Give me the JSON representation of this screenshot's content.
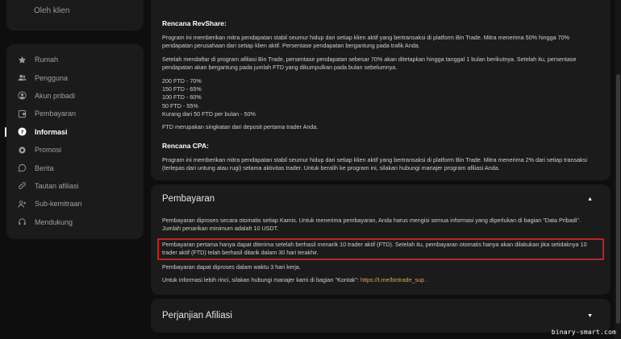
{
  "sidebar_top": {
    "label": "Oleh klien"
  },
  "sidebar": {
    "items": [
      {
        "label": "Rumah",
        "icon": "star-icon",
        "active": false
      },
      {
        "label": "Pengguna",
        "icon": "users-icon",
        "active": false
      },
      {
        "label": "Akun pribadi",
        "icon": "account-icon",
        "active": false
      },
      {
        "label": "Pembayaran",
        "icon": "wallet-icon",
        "active": false
      },
      {
        "label": "Informasi",
        "icon": "question-icon",
        "active": true
      },
      {
        "label": "Promosi",
        "icon": "gear-icon",
        "active": false
      },
      {
        "label": "Berita",
        "icon": "chat-icon",
        "active": false
      },
      {
        "label": "Tautan afiliasi",
        "icon": "link-icon",
        "active": false
      },
      {
        "label": "Sub-kemitraan",
        "icon": "add-user-icon",
        "active": false
      },
      {
        "label": "Mendukung",
        "icon": "headset-icon",
        "active": false
      }
    ]
  },
  "revshare": {
    "title": "Rencana RevShare:",
    "p1": "Program ini memberikan mitra pendapatan stabil seumur hidup dari setiap klien aktif yang bertransaksi di platform Bin Trade. Mitra menerima 50% hingga 70% pendapatan perusahaan dari setiap klien aktif. Persentase pendapatan bergantung pada trafik Anda.",
    "p2": "Setelah mendaftar di program afiliasi Bin Trade, persentase pendapatan sebesar 70% akan ditetapkan hingga tanggal 1 bulan berikutnya. Setelah itu, persentase pendapatan akan bergantung pada jumlah FTD yang dikumpulkan pada bulan sebelumnya.",
    "tiers": [
      "200 FTD - 70%",
      "150 FTD - 65%",
      "100 FTD - 60%",
      "50 FTD - 55%",
      "Kurang dari 50 FTD per bulan - 50%"
    ],
    "note": "FTD merupakan singkatan dari deposit pertama trader Anda."
  },
  "cpa": {
    "title": "Rencana CPA:",
    "p1": "Program ini memberikan mitra pendapatan stabil seumur hidup dari setiap klien aktif yang bertransaksi di platform Bin Trade. Mitra menerima 2% dari setiap transaksi (terlepas dari untung atau rugi) selama aktivitas trader. Untuk beralih ke program ini, silakan hubungi manajer program afiliasi Anda."
  },
  "payment": {
    "title": "Pembayaran",
    "chevron": "▲",
    "p1": "Pembayaran diproses secara otomatis setiap Kamis. Untuk menerima pembayaran, Anda harus mengisi semua informasi yang diperlukan di bagian \"Data Pribadi\". Jumlah penarikan minimum adalah 10 USDT.",
    "p_highlight": "Pembayaran pertama hanya dapat diterima setelah berhasil menarik 10 trader aktif (FTD). Setelah itu, pembayaran otomatis hanya akan dilakukan jika setidaknya 10 trader aktif (FTD) telah berhasil ditarik dalam 30 hari terakhir.",
    "p3": "Pembayaran dapat diproses dalam waktu 3 hari kerja.",
    "contact_prefix": "Untuk informasi lebih rinci, silakan hubungi manajer kami di bagian \"Kontak\": ",
    "contact_link": "https://t.me/bintrade_sup",
    "contact_suffix": " ."
  },
  "agreement": {
    "title": "Perjanjian Afiliasi",
    "chevron": "▼"
  },
  "watermark": "binary-smart.com",
  "colors": {
    "highlight_border": "#d11b1b",
    "link": "#e0a93a",
    "background": "#0e0e0e",
    "panel": "#1b1b1b"
  }
}
